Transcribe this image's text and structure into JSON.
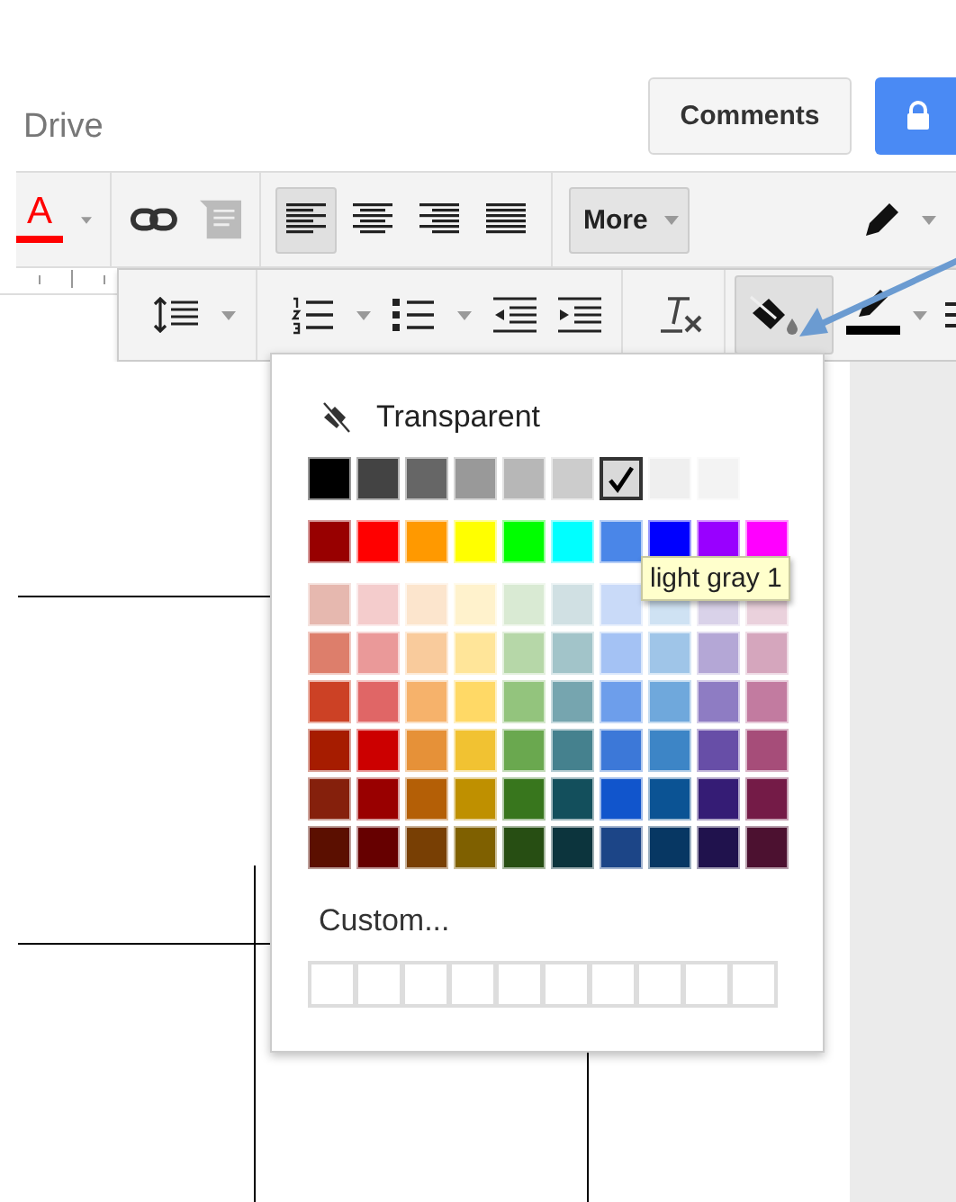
{
  "header": {
    "app_name": "Drive",
    "comments_button": "Comments"
  },
  "toolbar": {
    "text_color_letter": "A",
    "alignment": [
      {
        "selected": true
      },
      {
        "selected": false
      },
      {
        "selected": false
      },
      {
        "selected": false
      }
    ],
    "more_button": "More"
  },
  "secondary_toolbar": {
    "fill_color_button": {
      "selected": true
    }
  },
  "palette": {
    "transparent_label": "Transparent",
    "rows": [
      {
        "swatches": [
          {
            "color": "#000000",
            "selected": false
          },
          {
            "color": "#434343",
            "selected": false
          },
          {
            "color": "#666666",
            "selected": false
          },
          {
            "color": "#999999",
            "selected": false
          },
          {
            "color": "#b7b7b7",
            "selected": false
          },
          {
            "color": "#cccccc",
            "selected": false
          },
          {
            "color": "#d9d9d9",
            "selected": true
          },
          {
            "color": "#efefef",
            "selected": false
          },
          {
            "color": "#f3f3f3",
            "selected": false
          }
        ]
      },
      {
        "swatches": [
          {
            "color": "#980000",
            "selected": false
          },
          {
            "color": "#ff0000",
            "selected": false
          },
          {
            "color": "#ff9900",
            "selected": false
          },
          {
            "color": "#ffff00",
            "selected": false
          },
          {
            "color": "#00ff00",
            "selected": false
          },
          {
            "color": "#00ffff",
            "selected": false
          },
          {
            "color": "#4a86e8",
            "selected": false
          },
          {
            "color": "#0000ff",
            "selected": false
          },
          {
            "color": "#9900ff",
            "selected": false
          },
          {
            "color": "#ff00ff",
            "selected": false
          }
        ]
      },
      {
        "swatches": [
          {
            "color": "#e6b8af",
            "selected": false
          },
          {
            "color": "#f4cccc",
            "selected": false
          },
          {
            "color": "#fce5cd",
            "selected": false
          },
          {
            "color": "#fff2cc",
            "selected": false
          },
          {
            "color": "#d9ead3",
            "selected": false
          },
          {
            "color": "#d0e0e3",
            "selected": false
          },
          {
            "color": "#c9daf8",
            "selected": false
          },
          {
            "color": "#cfe2f3",
            "selected": false
          },
          {
            "color": "#d9d2e9",
            "selected": false
          },
          {
            "color": "#ead1dc",
            "selected": false
          }
        ]
      },
      {
        "swatches": [
          {
            "color": "#dd7e6b",
            "selected": false
          },
          {
            "color": "#ea9999",
            "selected": false
          },
          {
            "color": "#f9cb9c",
            "selected": false
          },
          {
            "color": "#ffe599",
            "selected": false
          },
          {
            "color": "#b6d7a8",
            "selected": false
          },
          {
            "color": "#a2c4c9",
            "selected": false
          },
          {
            "color": "#a4c2f4",
            "selected": false
          },
          {
            "color": "#9fc5e8",
            "selected": false
          },
          {
            "color": "#b4a7d6",
            "selected": false
          },
          {
            "color": "#d5a6bd",
            "selected": false
          }
        ]
      },
      {
        "swatches": [
          {
            "color": "#cc4125",
            "selected": false
          },
          {
            "color": "#e06666",
            "selected": false
          },
          {
            "color": "#f6b26b",
            "selected": false
          },
          {
            "color": "#ffd966",
            "selected": false
          },
          {
            "color": "#93c47d",
            "selected": false
          },
          {
            "color": "#76a5af",
            "selected": false
          },
          {
            "color": "#6d9eeb",
            "selected": false
          },
          {
            "color": "#6fa8dc",
            "selected": false
          },
          {
            "color": "#8e7cc3",
            "selected": false
          },
          {
            "color": "#c27ba0",
            "selected": false
          }
        ]
      },
      {
        "swatches": [
          {
            "color": "#a61c00",
            "selected": false
          },
          {
            "color": "#cc0000",
            "selected": false
          },
          {
            "color": "#e69138",
            "selected": false
          },
          {
            "color": "#f1c232",
            "selected": false
          },
          {
            "color": "#6aa84f",
            "selected": false
          },
          {
            "color": "#45818e",
            "selected": false
          },
          {
            "color": "#3c78d8",
            "selected": false
          },
          {
            "color": "#3d85c6",
            "selected": false
          },
          {
            "color": "#674ea7",
            "selected": false
          },
          {
            "color": "#a64d79",
            "selected": false
          }
        ]
      },
      {
        "swatches": [
          {
            "color": "#85200c",
            "selected": false
          },
          {
            "color": "#990000",
            "selected": false
          },
          {
            "color": "#b45f06",
            "selected": false
          },
          {
            "color": "#bf9000",
            "selected": false
          },
          {
            "color": "#38761d",
            "selected": false
          },
          {
            "color": "#134f5c",
            "selected": false
          },
          {
            "color": "#1155cc",
            "selected": false
          },
          {
            "color": "#0b5394",
            "selected": false
          },
          {
            "color": "#351c75",
            "selected": false
          },
          {
            "color": "#741b47",
            "selected": false
          }
        ]
      },
      {
        "swatches": [
          {
            "color": "#5b0f00",
            "selected": false
          },
          {
            "color": "#660000",
            "selected": false
          },
          {
            "color": "#783f04",
            "selected": false
          },
          {
            "color": "#7f6000",
            "selected": false
          },
          {
            "color": "#274e13",
            "selected": false
          },
          {
            "color": "#0c343d",
            "selected": false
          },
          {
            "color": "#1c4587",
            "selected": false
          },
          {
            "color": "#073763",
            "selected": false
          },
          {
            "color": "#20124d",
            "selected": false
          },
          {
            "color": "#4c1130",
            "selected": false
          }
        ]
      }
    ],
    "custom_label": "Custom..."
  },
  "tooltip": "light gray 1"
}
